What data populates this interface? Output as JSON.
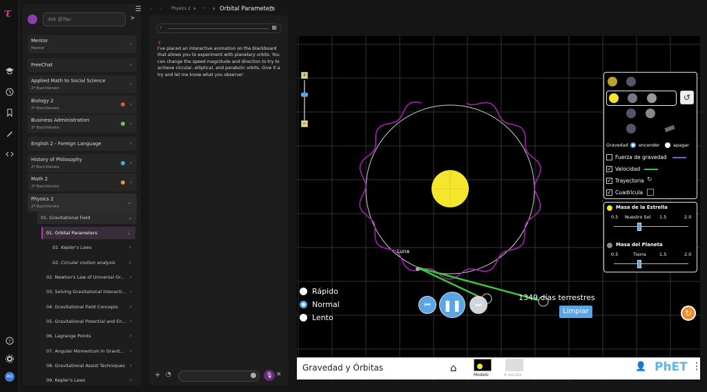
{
  "app": {
    "logo": "τ"
  },
  "rail": {
    "icons": [
      "cap-icon",
      "history-icon",
      "bookmark-icon",
      "pen-icon",
      "code-icon",
      "help-icon",
      "gear-icon"
    ],
    "avatar": "AG"
  },
  "ask": {
    "placeholder": "Ask @Tau"
  },
  "sidebar": {
    "items": [
      {
        "label": "Mentor",
        "sub": "Mentor"
      },
      {
        "label": "FreeChat",
        "sub": ""
      },
      {
        "label": "Applied Math to Social Science",
        "sub": "2º Bachillerato"
      },
      {
        "label": "Biology 2",
        "sub": "2º Bachillerato",
        "dot": "#e0554a"
      },
      {
        "label": "Business Administration",
        "sub": "2º Bachillerato",
        "dot": "#7ec34a"
      },
      {
        "label": "English 2 - Foreign Language",
        "sub": ""
      },
      {
        "label": "History of Philosophy",
        "sub": "2º Bachillerato",
        "dot": "#3fb7c9"
      },
      {
        "label": "Math 2",
        "sub": "2º Bachillerato",
        "dot": "#e8903a"
      },
      {
        "label": "Physics 2",
        "sub": "2º Bachillerato"
      }
    ],
    "tree": [
      "01. Gravitational Field",
      "01. Orbital Parameters",
      "01. Kepler's Laws",
      "02. Circular motion analysis",
      "02. Newton's Law of Universal Gr...",
      "03. Solving Gravitational Interacti...",
      "04. Gravitational Field Concepts",
      "05. Gravitational Potential and En...",
      "06. Lagrange Points",
      "07. Angular Momentum in Gravit...",
      "08. Gravitational Assist Techniques",
      "09. Kepler's Laws"
    ]
  },
  "breadcrumb": {
    "course": "Physics 2",
    "sep": "›",
    "ellipsis": "···",
    "title": "Orbital Parameters"
  },
  "chat": {
    "message": "I've placed an interactive animation on the blackboard that allows you to experiment with planetary orbits. You can change the speed magnitude and direction to try to achieve circular, elliptical, and parabolic orbits. Give it a try and let me know what you observe!"
  },
  "sim": {
    "moon_label": "Luna",
    "time_readout": "1349 días terrestres",
    "clear": "Limpiar",
    "speeds": [
      "Rápido",
      "Normal",
      "Lento"
    ],
    "selected_speed": "Normal",
    "gravity": {
      "label": "Gravedad",
      "on": "encender",
      "off": "apagar",
      "state": "encender"
    },
    "checks": [
      {
        "label": "Fuerza de gravedad",
        "checked": false
      },
      {
        "label": "Velocidad",
        "checked": true
      },
      {
        "label": "Trayectoria",
        "checked": true
      },
      {
        "label": "Cuadrícula",
        "checked": true
      }
    ],
    "star_mass": {
      "title": "Masa de la Estrella",
      "ticks": [
        "0.5",
        "Nuestro Sol",
        "1.5",
        "2.0"
      ],
      "value": 1.0
    },
    "planet_mass": {
      "title": "Masa del Planeta",
      "ticks": [
        "0.5",
        "Tierra",
        "1.5",
        "2.0"
      ],
      "value": 1.0
    },
    "title": "Gravedad y Órbitas",
    "screens": [
      "Modelo",
      "A escala"
    ],
    "brand": "PhET",
    "colors": {
      "sun": "#f4e62a",
      "path": "#b21fc0",
      "velocity": "#3cc83c",
      "ui_blue": "#5aa5e6",
      "reset": "#f08a24"
    }
  }
}
